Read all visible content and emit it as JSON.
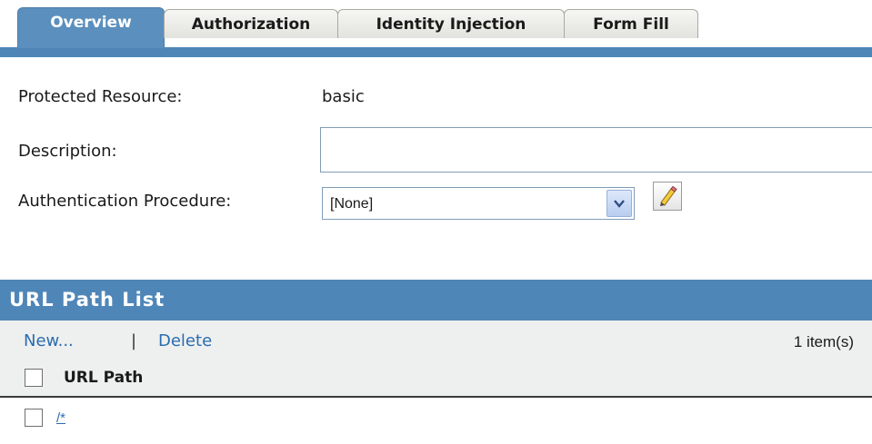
{
  "tabs": [
    {
      "label": "Overview",
      "active": true
    },
    {
      "label": "Authorization",
      "active": false
    },
    {
      "label": "Identity Injection",
      "active": false
    },
    {
      "label": "Form Fill",
      "active": false
    }
  ],
  "form": {
    "protected_resource_label": "Protected Resource:",
    "protected_resource_value": "basic",
    "description_label": "Description:",
    "description_value": "",
    "auth_procedure_label": "Authentication Procedure:",
    "auth_procedure_selected": "[None]"
  },
  "url_path_list": {
    "title": "URL Path List",
    "new_label": "New...",
    "separator": "|",
    "delete_label": "Delete",
    "item_count": "1 item(s)",
    "column_header": "URL Path",
    "rows": [
      {
        "path": "/*",
        "checked": false
      }
    ]
  },
  "colors": {
    "tab_active": "#5b8fbd",
    "header_bar": "#4f86b8",
    "link": "#2a6cb0",
    "toolbar_bg": "#eef0ef"
  },
  "icons": {
    "dropdown": "chevron-down-icon",
    "edit": "pencil-icon"
  }
}
